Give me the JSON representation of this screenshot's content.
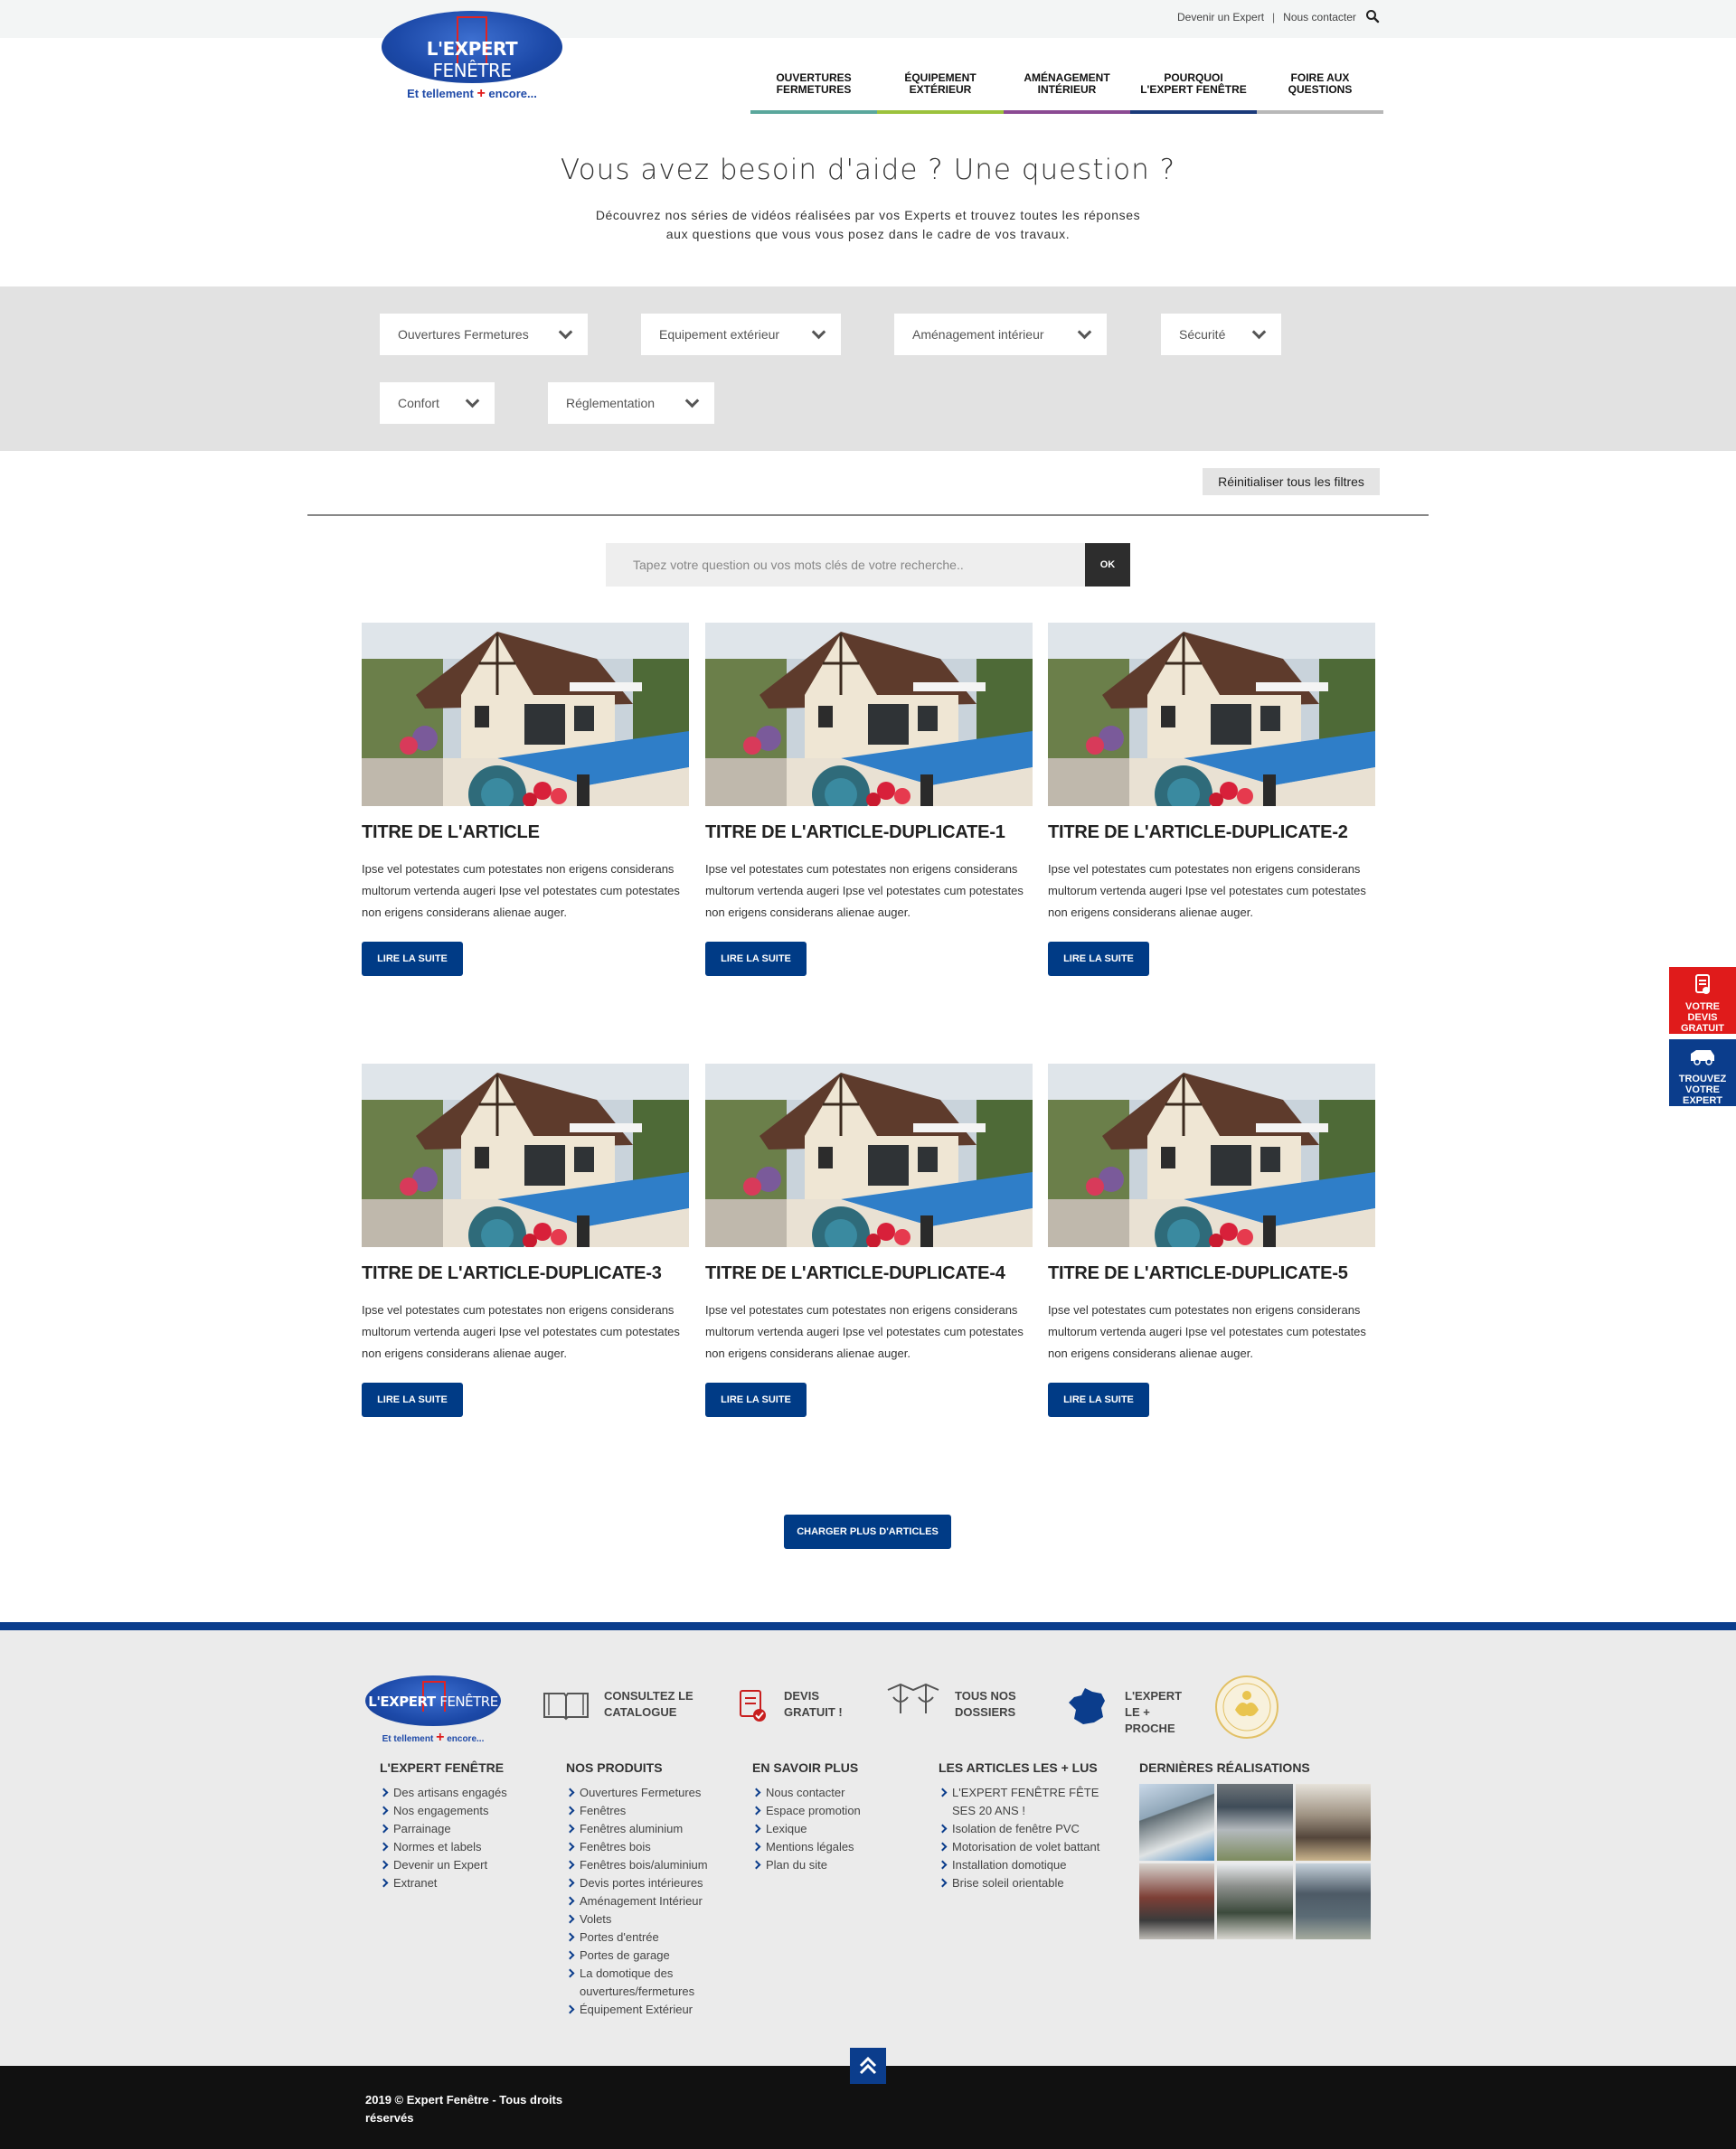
{
  "topbar": {
    "links": [
      "Devenir un Expert",
      "Nous contacter"
    ],
    "separator": "|"
  },
  "logo": {
    "brand_bold": "L'EXPERT",
    "brand_thin": "FENÊTRE",
    "tagline_start": "Et tellement",
    "tagline_plus": "+",
    "tagline_end": "encore..."
  },
  "nav": [
    {
      "line1": "Ouvertures",
      "line2": "Fermetures",
      "color": "#5aa79c"
    },
    {
      "line1": "Équipement",
      "line2": "extérieur",
      "color": "#9cc23c"
    },
    {
      "line1": "Aménagement",
      "line2": "intérieur",
      "color": "#8b4a93"
    },
    {
      "line1": "Pourquoi",
      "line2": "L'Expert Fenêtre",
      "color": "#1a3a7a"
    },
    {
      "line1": "Foire aux",
      "line2": "questions",
      "color": "#b8b8b8"
    }
  ],
  "hero": {
    "title": "Vous avez besoin d'aide ? Une question ?",
    "subtitle_line1": "Découvrez nos séries de vidéos réalisées par vos Experts et trouvez toutes les réponses",
    "subtitle_line2": "aux questions que vous vous posez dans le cadre de vos travaux."
  },
  "filters": [
    "Ouvertures Fermetures",
    "Equipement extérieur",
    "Aménagement intérieur",
    "Sécurité",
    "Confort",
    "Réglementation"
  ],
  "reset_label": "Réinitialiser tous les filtres",
  "search": {
    "placeholder": "Tapez votre question ou vos mots clés de votre recherche..",
    "button": "OK"
  },
  "articles": [
    {
      "title": "TITRE DE L'ARTICLE",
      "text": "Ipse vel potestates cum potestates non erigens considerans multorum vertenda augeri Ipse vel potestates cum potestates non erigens considerans alienae auger.",
      "button": "LIRE LA SUITE"
    },
    {
      "title": "TITRE DE L'ARTICLE-DUPLICATE-1",
      "text": "Ipse vel potestates cum potestates non erigens considerans multorum vertenda augeri Ipse vel potestates cum potestates non erigens considerans alienae auger.",
      "button": "LIRE LA SUITE"
    },
    {
      "title": "TITRE DE L'ARTICLE-DUPLICATE-2",
      "text": "Ipse vel potestates cum potestates non erigens considerans multorum vertenda augeri Ipse vel potestates cum potestates non erigens considerans alienae auger.",
      "button": "LIRE LA SUITE"
    },
    {
      "title": "TITRE DE L'ARTICLE-DUPLICATE-3",
      "text": "Ipse vel potestates cum potestates non erigens considerans multorum vertenda augeri Ipse vel potestates cum potestates non erigens considerans alienae auger.",
      "button": "LIRE LA SUITE"
    },
    {
      "title": "TITRE DE L'ARTICLE-DUPLICATE-4",
      "text": "Ipse vel potestates cum potestates non erigens considerans multorum vertenda augeri Ipse vel potestates cum potestates non erigens considerans alienae auger.",
      "button": "LIRE LA SUITE"
    },
    {
      "title": "TITRE DE L'ARTICLE-DUPLICATE-5",
      "text": "Ipse vel potestates cum potestates non erigens considerans multorum vertenda augeri Ipse vel potestates cum potestates non erigens considerans alienae auger.",
      "button": "LIRE LA SUITE"
    }
  ],
  "load_more": "CHARGER PLUS D'ARTICLES",
  "side_tabs": [
    {
      "lines": [
        "Votre",
        "devis",
        "gratuit"
      ],
      "color": "#e01b1b",
      "icon": "document-icon"
    },
    {
      "lines": [
        "Trouvez",
        "votre",
        "expert"
      ],
      "color": "#0b3d8c",
      "icon": "van-icon"
    }
  ],
  "footer": {
    "features": [
      {
        "line1": "Consultez le",
        "line2": "catalogue",
        "icon": "book-icon"
      },
      {
        "line1": "Devis",
        "line2": "gratuit !",
        "icon": "quote-icon"
      },
      {
        "line1": "Tous nos",
        "line2": "dossiers",
        "icon": "folder-icon"
      },
      {
        "line1": "L'Expert",
        "line2": "le + proche",
        "icon": "france-map-icon"
      }
    ],
    "columns": [
      {
        "title": "L'Expert Fenêtre",
        "items": [
          "Des artisans engagés",
          "Nos engagements",
          "Parrainage",
          "Normes et labels",
          "Devenir un Expert",
          "Extranet"
        ]
      },
      {
        "title": "Nos produits",
        "items": [
          "Ouvertures Fermetures",
          "Fenêtres",
          "Fenêtres aluminium",
          "Fenêtres bois",
          "Fenêtres bois/aluminium",
          "Devis portes intérieures",
          "Aménagement Intérieur",
          "Volets",
          "Portes d'entrée",
          "Portes de garage",
          "La domotique des ouvertures/fermetures",
          "Équipement Extérieur"
        ]
      },
      {
        "title": "En savoir plus",
        "items": [
          "Nous contacter",
          "Espace promotion",
          "Lexique",
          "Mentions légales",
          "Plan du site"
        ]
      },
      {
        "title": "Les articles les + lus",
        "items": [
          "L'EXPERT FENÊTRE FÊTE SES 20 ANS !",
          "Isolation de fenêtre PVC",
          "Motorisation de volet battant",
          "Installation domotique",
          "Brise soleil orientable"
        ]
      }
    ],
    "gallery_title": "Dernières réalisations",
    "copyright_line1": "2019 © Expert Fenêtre - Tous droits",
    "copyright_line2": "réservés"
  }
}
